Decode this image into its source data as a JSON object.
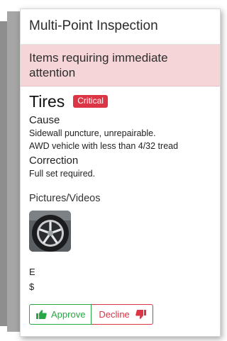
{
  "header": {
    "title": "Multi-Point Inspection"
  },
  "alert": {
    "text": "Items requiring immediate attention"
  },
  "item": {
    "name": "Tires",
    "severity": "Critical",
    "cause_label": "Cause",
    "cause_lines": [
      "Sidewall puncture, unrepairable.",
      "AWD vehicle with less than 4/32 tread"
    ],
    "correction_label": "Correction",
    "correction_text": "Full set required."
  },
  "media": {
    "label": "Pictures/Videos",
    "thumbnail_icon": "tire-wheel-image"
  },
  "clipped_lines": [
    "E",
    "$"
  ],
  "actions": {
    "approve_label": "Approve",
    "approve_icon": "thumbs-up-icon",
    "decline_label": "Decline",
    "decline_icon": "thumbs-down-icon"
  },
  "colors": {
    "alert_bg": "#f5d5d7",
    "critical": "#dc3545",
    "approve": "#28a745"
  }
}
